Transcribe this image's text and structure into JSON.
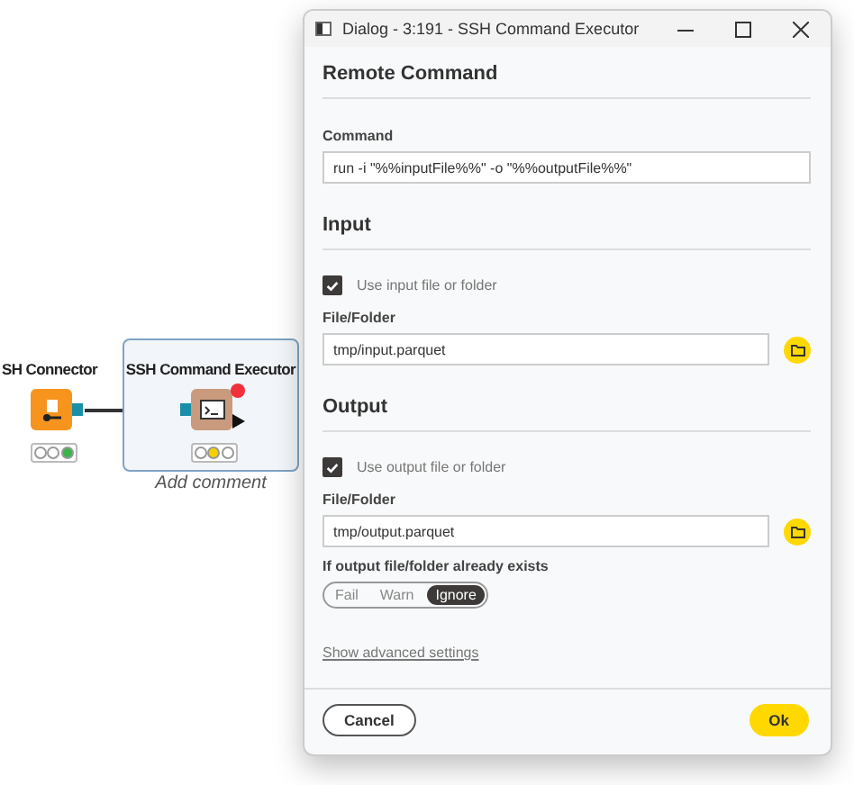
{
  "canvas": {
    "nodes": [
      {
        "label": "SH Connector",
        "kind": "connector",
        "lights": [
          {
            "on": false
          },
          {
            "on": false
          },
          {
            "on": true
          }
        ],
        "selected": false,
        "error": false
      },
      {
        "label": "SSH Command Executor",
        "kind": "command",
        "lights": [
          {
            "on": false
          },
          {
            "on": true
          },
          {
            "on": false
          }
        ],
        "selected": true,
        "error": true,
        "comment": "Add comment"
      }
    ]
  },
  "dialog": {
    "title": "Dialog - 3:191 - SSH Command Executor",
    "sections": [
      {
        "heading": "Remote Command",
        "fields": [
          {
            "kind": "text",
            "label": "Command",
            "value": "run -i \"%%inputFile%%\" -o \"%%outputFile%%\""
          }
        ]
      },
      {
        "heading": "Input",
        "fields": [
          {
            "kind": "checkbox",
            "label": "Use input file or folder",
            "checked": true
          },
          {
            "kind": "file",
            "label": "File/Folder",
            "value": "tmp/input.parquet"
          }
        ]
      },
      {
        "heading": "Output",
        "fields": [
          {
            "kind": "checkbox",
            "label": "Use output file or folder",
            "checked": true
          },
          {
            "kind": "file",
            "label": "File/Folder",
            "value": "tmp/output.parquet"
          },
          {
            "kind": "toggle",
            "label": "If output file/folder already exists",
            "options": [
              {
                "label": "Fail",
                "selected": false
              },
              {
                "label": "Warn",
                "selected": false
              },
              {
                "label": "Ignore",
                "selected": true
              }
            ]
          }
        ]
      }
    ],
    "advanced_link": "Show advanced settings",
    "buttons": [
      {
        "label": "Cancel",
        "kind": "secondary"
      },
      {
        "label": "Ok",
        "kind": "primary"
      }
    ]
  }
}
